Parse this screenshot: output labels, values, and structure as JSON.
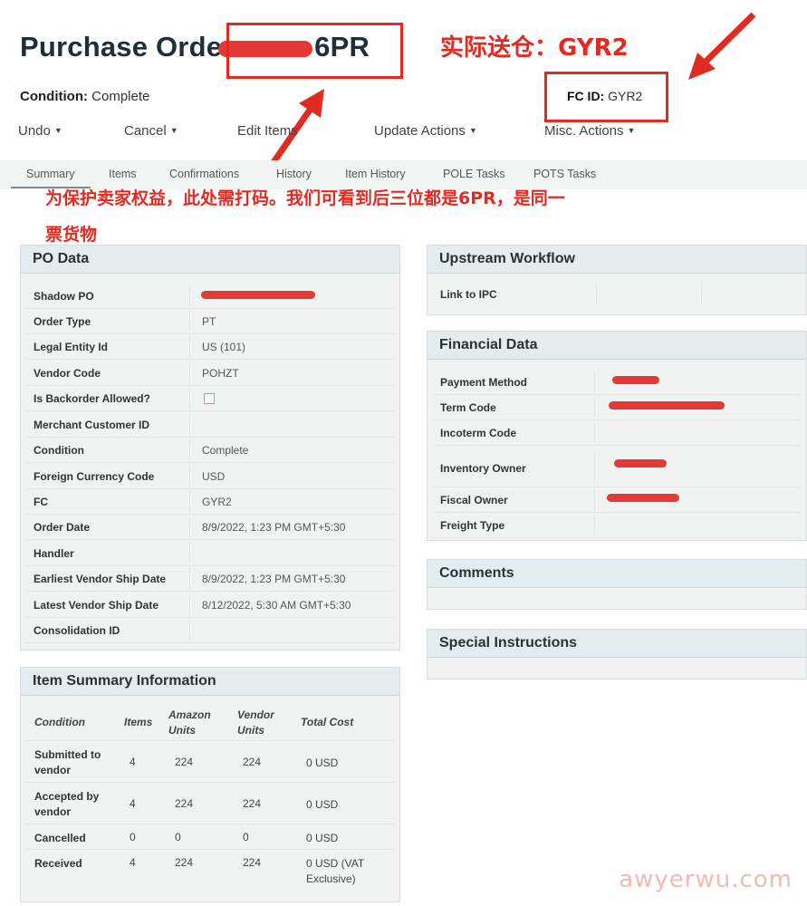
{
  "header": {
    "title_prefix": "Purchase Orde",
    "title_suffix": "6PR",
    "condition_label": "Condition:",
    "condition_value": "Complete",
    "fc_label": "FC ID:",
    "fc_value": "GYR2"
  },
  "annotations": {
    "actual_fc": "实际送仓：GYR2",
    "note_line1": "为保护卖家权益，此处需打码。我们可看到后三位都是6PR，是同一",
    "note_line2": "票货物"
  },
  "toolbar": [
    {
      "label": "Undo"
    },
    {
      "label": "Cancel"
    },
    {
      "label": "Edit Items"
    },
    {
      "label": "Update Actions"
    },
    {
      "label": "Misc. Actions"
    }
  ],
  "tabs": [
    {
      "label": "Summary",
      "active": true
    },
    {
      "label": "Items"
    },
    {
      "label": "Confirmations"
    },
    {
      "label": "History"
    },
    {
      "label": "Item History"
    },
    {
      "label": "POLE Tasks"
    },
    {
      "label": "POTS Tasks"
    }
  ],
  "po_data": {
    "title": "PO Data",
    "rows": [
      {
        "label": "Shadow PO",
        "value": ""
      },
      {
        "label": "Order Type",
        "value": "PT"
      },
      {
        "label": "Legal Entity Id",
        "value": "US (101)"
      },
      {
        "label": "Vendor Code",
        "value": "POHZT"
      },
      {
        "label": "Is Backorder Allowed?",
        "value": ""
      },
      {
        "label": "Merchant Customer ID",
        "value": ""
      },
      {
        "label": "Condition",
        "value": "Complete"
      },
      {
        "label": "Foreign Currency Code",
        "value": "USD"
      },
      {
        "label": "FC",
        "value": "GYR2"
      },
      {
        "label": "Order Date",
        "value": "8/9/2022, 1:23 PM GMT+5:30"
      },
      {
        "label": "Handler",
        "value": ""
      },
      {
        "label": "Earliest Vendor Ship Date",
        "value": "8/9/2022, 1:23 PM GMT+5:30"
      },
      {
        "label": "Latest Vendor Ship Date",
        "value": "8/12/2022, 5:30 AM GMT+5:30"
      },
      {
        "label": "Consolidation ID",
        "value": ""
      }
    ]
  },
  "item_summary": {
    "title": "Item Summary Information",
    "headers": [
      "Condition",
      "Items",
      "Amazon Units",
      "Vendor Units",
      "Total Cost"
    ],
    "rows": [
      {
        "condition": "Submitted to vendor",
        "items": "4",
        "amazon": "224",
        "vendor": "224",
        "cost": "0 USD"
      },
      {
        "condition": "Accepted by vendor",
        "items": "4",
        "amazon": "224",
        "vendor": "224",
        "cost": "0 USD"
      },
      {
        "condition": "Cancelled",
        "items": "0",
        "amazon": "0",
        "vendor": "0",
        "cost": "0 USD"
      },
      {
        "condition": "Received",
        "items": "4",
        "amazon": "224",
        "vendor": "224",
        "cost": "0 USD (VAT Exclusive)"
      }
    ]
  },
  "upstream": {
    "title": "Upstream Workflow",
    "rows": [
      {
        "label": "Link to IPC",
        "value": ""
      }
    ]
  },
  "financial": {
    "title": "Financial Data",
    "rows": [
      {
        "label": "Payment Method"
      },
      {
        "label": "Term Code"
      },
      {
        "label": "Incoterm Code"
      },
      {
        "label": "Inventory Owner"
      },
      {
        "label": "Fiscal Owner"
      },
      {
        "label": "Freight Type"
      }
    ]
  },
  "comments": {
    "title": "Comments"
  },
  "special": {
    "title": "Special Instructions"
  },
  "watermark": "awyerwu.com",
  "colors": {
    "annotation_red": "#e12a22",
    "redaction_red": "#e53935",
    "panel_header": "#e5eced"
  }
}
